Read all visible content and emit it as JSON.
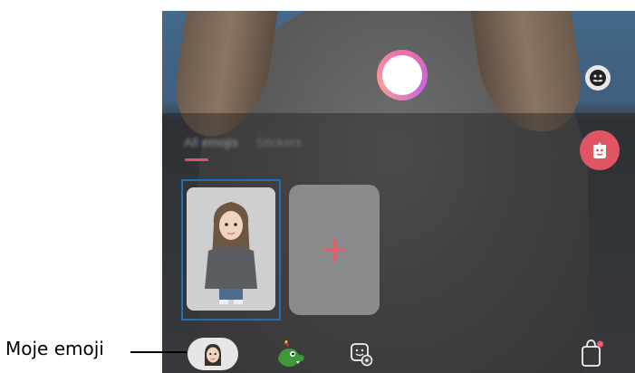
{
  "tabs": [
    {
      "label": "All emojis",
      "active": true
    },
    {
      "label": "Stickers",
      "active": false
    }
  ],
  "add_card": {
    "symbol": "+"
  },
  "callout": {
    "label": "Moje emoji"
  },
  "icons": {
    "shutter": "shutter-button",
    "mask": "mask-icon",
    "ar": "ar-emoji-icon",
    "my_emoji": "my-emoji-avatar-icon",
    "stickers": "dinosaur-sticker-icon",
    "settings": "emoji-settings-icon",
    "store": "shopping-bag-icon"
  },
  "colors": {
    "accent": "#e05563",
    "highlight": "#1f6fb5"
  }
}
